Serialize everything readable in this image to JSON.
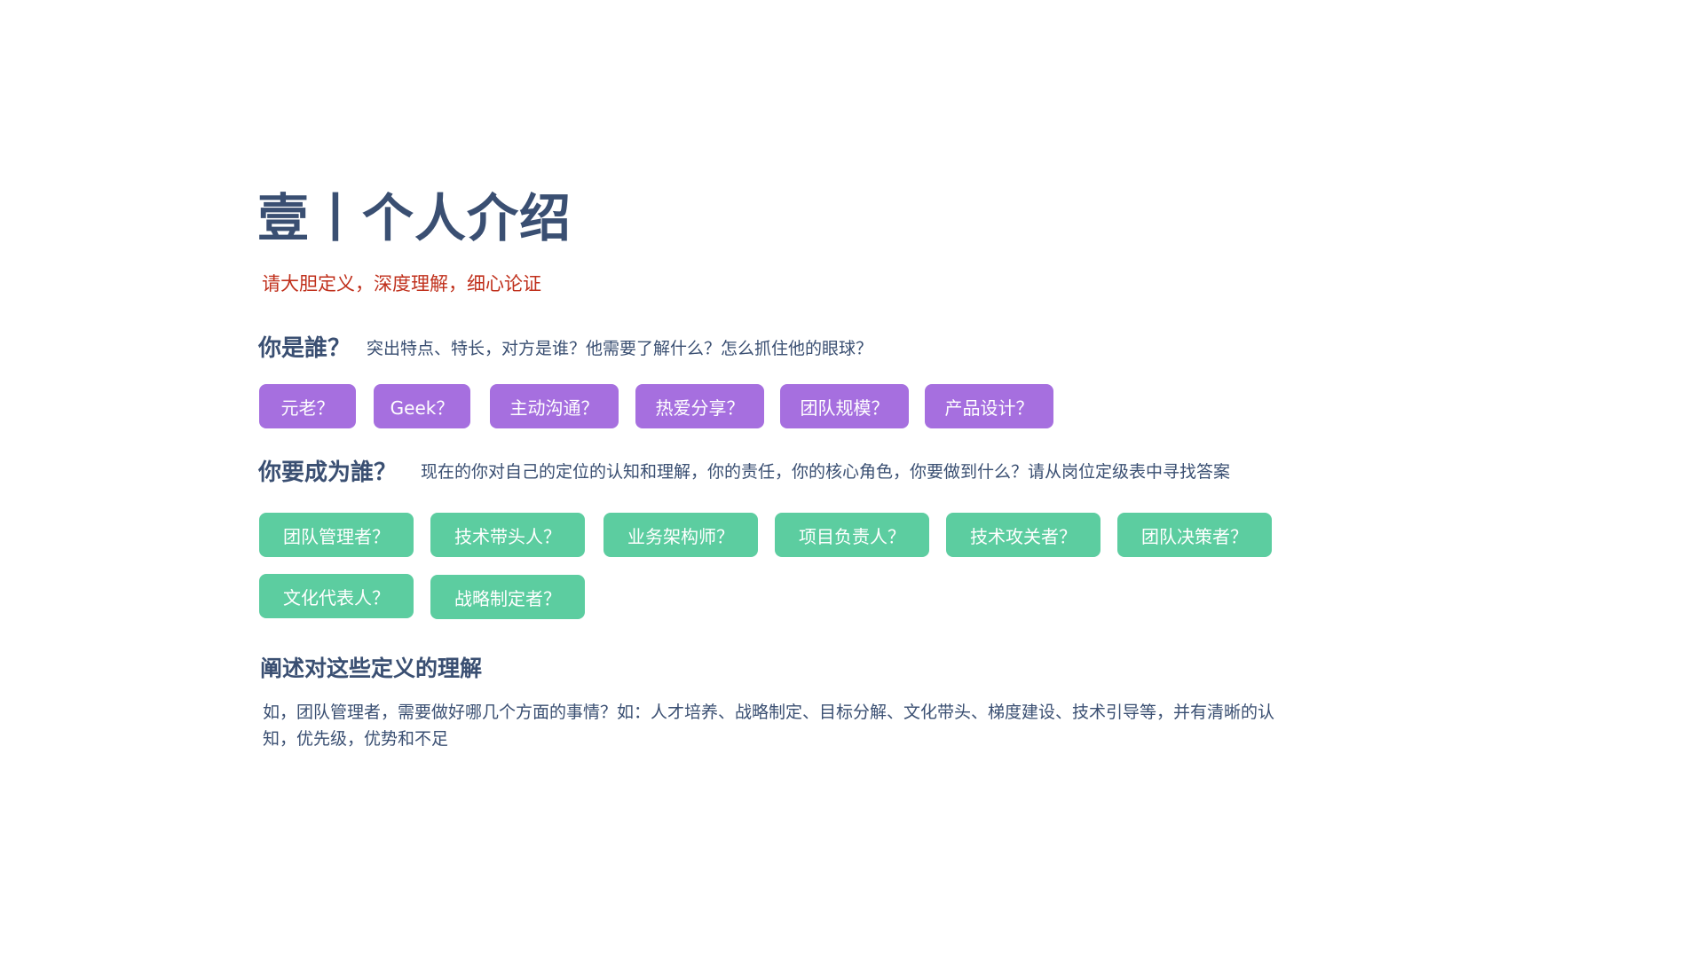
{
  "title": "壹丨个人介绍",
  "subtitle": "请大胆定义，深度理解，细心论证",
  "who_are_you": {
    "heading": "你是誰？",
    "description": "突出特点、特长，对方是谁？他需要了解什么？怎么抓住他的眼球？",
    "tags": [
      "元老？",
      "Geek？",
      "主动沟通？",
      "热爱分享？",
      "团队规模？",
      "产品设计？"
    ],
    "tag_color": "#a66fdf"
  },
  "who_to_become": {
    "heading": "你要成为誰？",
    "description": "现在的你对自己的定位的认知和理解，你的责任，你的核心角色，你要做到什么？请从岗位定级表中寻找答案",
    "tags": [
      "团队管理者？",
      "技术带头人？",
      "业务架构师？",
      "项目负责人？",
      "技术攻关者？",
      "团队决策者？",
      "文化代表人？",
      "战略制定者？"
    ],
    "tag_color": "#5ccda0"
  },
  "elaborate": {
    "heading": "阐述对这些定义的理解",
    "paragraph": "如，团队管理者，需要做好哪几个方面的事情？如：人才培养、战略制定、目标分解、文化带头、梯度建设、技术引导等，并有清晰的认知，优先级，优势和不足"
  },
  "colors": {
    "text": "#3a4f72",
    "subtitle": "#c0301c"
  }
}
